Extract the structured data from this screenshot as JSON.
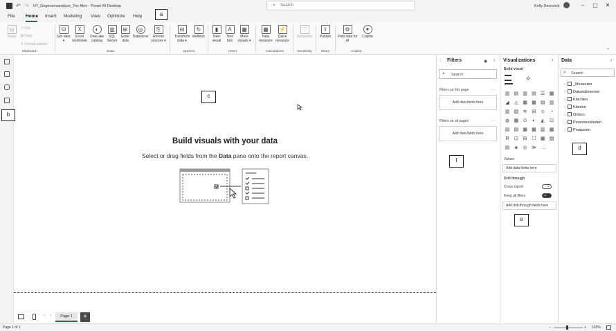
{
  "window": {
    "title": "H7_Gegevensanalyse_Tex-Mex - Power BI Desktop",
    "search_placeholder": "Search",
    "user": "Kelly Decroock"
  },
  "menu": {
    "tabs": [
      "File",
      "Home",
      "Insert",
      "Modeling",
      "View",
      "Optimize",
      "Help"
    ]
  },
  "ribbon": {
    "clipboard": {
      "paste": "Paste",
      "cut": "Cut",
      "copy": "Copy",
      "format_painter": "Format painter",
      "group": "Clipboard"
    },
    "data": {
      "get_data": "Get data",
      "excel": "Excel workbook",
      "onelake": "OneLake catalog",
      "sql": "SQL Server",
      "enter": "Enter data",
      "dataverse": "Dataverse",
      "recent": "Recent sources",
      "group": "Data"
    },
    "queries": {
      "transform": "Transform data",
      "refresh": "Refresh",
      "group": "Queries"
    },
    "insert": {
      "new_visual": "New visual",
      "text_box": "Text box",
      "more_visuals": "More visuals",
      "group": "Insert"
    },
    "calculations": {
      "new_measure": "New measure",
      "quick_measure": "Quick measure",
      "group": "Calculations"
    },
    "sensitivity": {
      "sensitivity": "Sensitivity",
      "group": "Sensitivity"
    },
    "share": {
      "publish": "Publish",
      "group": "Share"
    },
    "copilot": {
      "prep": "Prep data for AI",
      "copilot": "Copilot",
      "group": "Copilot"
    }
  },
  "canvas": {
    "title": "Build visuals with your data",
    "subtitle_pre": "Select or drag fields from the ",
    "subtitle_bold": "Data",
    "subtitle_post": " pane onto the report canvas."
  },
  "pages": {
    "page1": "Page 1",
    "status": "Page 1 of 1",
    "zoom": "103%"
  },
  "filters": {
    "title": "Filters",
    "search": "Search",
    "on_page": "Filters on this page",
    "on_all": "Filters on all pages",
    "add_fields": "Add data fields here"
  },
  "visualizations": {
    "title": "Visualizations",
    "build": "Build visual",
    "values": "Values",
    "values_add": "Add data fields here",
    "drill": "Drill through",
    "cross_report": "Cross-report",
    "cross_report_state": "Off",
    "keep_filters": "Keep all filters",
    "keep_filters_state": "On",
    "drill_add": "Add drill-through fields here"
  },
  "data": {
    "title": "Data",
    "search": "Search",
    "tables": [
      "_Measures",
      "Datumdimensie",
      "Klachten",
      "Klanten",
      "Orders",
      "Personeelsleden",
      "Producten"
    ]
  },
  "callouts": {
    "a": "a",
    "b": "b",
    "c": "c",
    "d": "d",
    "e": "e",
    "f": "f"
  }
}
